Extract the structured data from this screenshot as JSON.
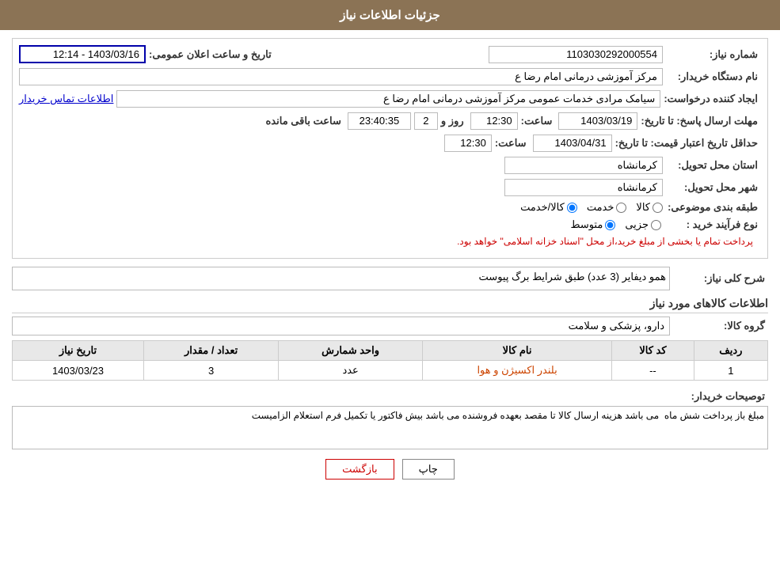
{
  "header": {
    "title": "جزئیات اطلاعات نیاز"
  },
  "fields": {
    "shomareNiaz_label": "شماره نیاز:",
    "shomareNiaz_value": "1103030292000554",
    "namDastgah_label": "نام دستگاه خریدار:",
    "namDastgah_value": "مرکز آموزشی  درمانی امام رضا  ع",
    "ijadKonande_label": "ایجاد کننده درخواست:",
    "ijadKonande_value": "سیامک مرادی خدمات عمومی مرکز آموزشی  درمانی امام رضا  ع",
    "ijadKonande_link": "اطلاعات تماس خریدار",
    "mohlat_label": "مهلت ارسال پاسخ: تا تاریخ:",
    "mohlat_date": "1403/03/19",
    "mohlat_time_label": "ساعت:",
    "mohlat_time": "12:30",
    "mohlat_roz_label": "روز و",
    "mohlat_roz": "2",
    "mohlat_remaining_label": "ساعت باقی مانده",
    "mohlat_timer": "23:40:35",
    "tarikhAetibar_label": "حداقل تاریخ اعتبار قیمت: تا تاریخ:",
    "tarikhAetibar_date": "1403/04/31",
    "tarikhAetibar_time_label": "ساعت:",
    "tarikhAetibar_time": "12:30",
    "ostan_label": "استان محل تحویل:",
    "ostan_value": "کرمانشاه",
    "shahr_label": "شهر محل تحویل:",
    "shahr_value": "کرمانشاه",
    "tabaqe_label": "طبقه بندی موضوعی:",
    "tabaqe_kala": "کالا",
    "tabaqe_khadamat": "خدمت",
    "tabaqe_kala_khadamat": "کالا/خدمت",
    "noeFarayand_label": "نوع فرآیند خرید :",
    "noeFarayand_jazee": "جزیی",
    "noeFarayand_motavaset": "متوسط",
    "noeFarayand_warn": "پرداخت تمام یا بخشی از مبلغ خرید،از محل \"اسناد خزانه اسلامی\" خواهد بود.",
    "sharh_label": "شرح کلی نیاز:",
    "sharh_value": "همو دیفایر (3 عدد) طبق شرایط برگ پیوست",
    "kalaha_title": "اطلاعات کالاهای مورد نیاز",
    "goroh_label": "گروه کالا:",
    "goroh_value": "دارو، پزشکی و سلامت",
    "table": {
      "headers": [
        "ردیف",
        "کد کالا",
        "نام کالا",
        "واحد شمارش",
        "تعداد / مقدار",
        "تاریخ نیاز"
      ],
      "rows": [
        {
          "radif": "1",
          "kod": "--",
          "name": "بلندر اکسیژن و هوا",
          "vahed": "عدد",
          "tedad": "3",
          "tarikh": "1403/03/23"
        }
      ]
    },
    "tosihKharidar_label": "توصیحات خریدار:",
    "tosihKharidar_value": "مبلغ باز پرداخت شش ماه  می باشد هزینه ارسال کالا تا مقصد بعهده فروشنده می باشد بیش فاکتور یا تکمیل فرم استعلام الزامیست",
    "tarikhDate_label": "تاریخ و ساعت اعلان عمومی:",
    "tarikhDate_value": "1403/03/16 - 12:14",
    "btn_print": "چاپ",
    "btn_back": "بازگشت"
  }
}
